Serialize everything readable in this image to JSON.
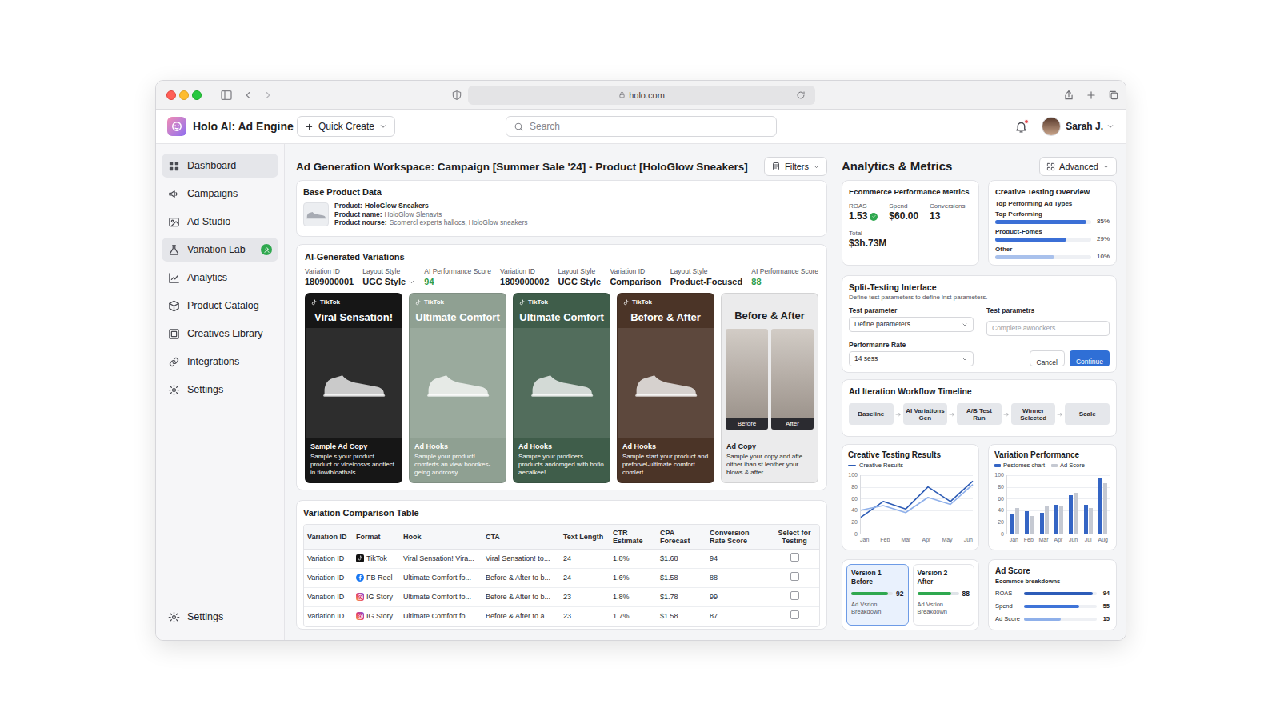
{
  "browser": {
    "url": "holo.com"
  },
  "header": {
    "logo": "Holo AI: Ad Engine",
    "quick_create": "Quick Create",
    "search": {
      "placeholder": "Search"
    },
    "notifications": {
      "unread": true
    },
    "user": "Sarah J."
  },
  "sidebar": {
    "items": [
      {
        "label": "Dashboard",
        "selected": true,
        "badge": false
      },
      {
        "label": "Campaigns",
        "selected": false,
        "badge": false
      },
      {
        "label": "Ad Studio",
        "selected": false,
        "badge": false
      },
      {
        "label": "Variation Lab",
        "selected": true,
        "badge": true
      },
      {
        "label": "Analytics",
        "selected": false,
        "badge": false
      },
      {
        "label": "Product Catalog",
        "selected": false,
        "badge": false
      },
      {
        "label": "Creatives Library",
        "selected": false,
        "badge": false
      },
      {
        "label": "Integrations",
        "selected": false,
        "badge": false
      },
      {
        "label": "Settings",
        "selected": false,
        "badge": false
      }
    ],
    "footer": {
      "label": "Settings",
      "selected": false
    }
  },
  "workspace": {
    "title": "Ad Generation Workspace: Campaign [Summer Sale '24] - Product [HoloGlow Sneakers]",
    "filters": "Filters",
    "product": {
      "heading": "Base Product Data",
      "fields": [
        {
          "label": "Product:",
          "value": "HoloGlow Sneakers",
          "kind": "primary"
        },
        {
          "label": "Product name:",
          "value": "HoloGlow Slenavts",
          "kind": "detail"
        },
        {
          "label": "Product nourse:",
          "value": "Scomercl experts hallocs, HoloGlow sneakers",
          "kind": "detail"
        }
      ]
    },
    "variations": {
      "heading": "AI-Generated Variations",
      "meta": [
        {
          "label": "Variation ID",
          "value": "1809000001",
          "kind": "text"
        },
        {
          "label": "Layout Style",
          "value": "UGC Style",
          "kind": "dropdown"
        },
        {
          "label": "AI Performance Score",
          "value": "94",
          "kind": "score"
        },
        {
          "label": "Variation ID",
          "value": "1809000002",
          "kind": "text"
        },
        {
          "label": "Layout Style",
          "value": "UGC Style",
          "kind": "text"
        },
        {
          "label": "Variation ID",
          "value": "Comparison",
          "kind": "text"
        },
        {
          "label": "Layout Style",
          "value": "Product-Focused",
          "kind": "text"
        },
        {
          "label": "AI Performance Score",
          "value": "88",
          "kind": "score"
        }
      ],
      "cards": [
        {
          "kind": "hero",
          "platform": "TikTok",
          "title": "Viral Sensation!",
          "copy_label": "Sample Ad Copy",
          "copy": "Sample s your product product or viceicosvs anotiect in tiowibloathals...",
          "color": "#161616"
        },
        {
          "kind": "hero",
          "platform": "TikTok",
          "title": "Ultimate Comfort",
          "copy_label": "Ad Hooks",
          "copy": "Sample your product! comferts an view boonkes-geing andrcosy...",
          "color": "#8fa092"
        },
        {
          "kind": "hero",
          "platform": "TikTok",
          "title": "Ultimate Comfort",
          "copy_label": "Ad Hooks",
          "copy": "Sampre your prodicers products andomged with hofio aecaikee!",
          "color": "#3f5d4a"
        },
        {
          "kind": "hero",
          "platform": "TikTok",
          "title": "Before & After",
          "copy_label": "Ad Hooks",
          "copy": "Sample start your product and preforvel-ultimate comfort comlert.",
          "color": "#4b3427"
        },
        {
          "kind": "split",
          "title": "Before & After",
          "panels": [
            "Before",
            "After"
          ],
          "copy_label": "Ad Copy",
          "copy": "Sample your copy and afte oither ihan st leother your blows & after.",
          "color": "#ebebec"
        }
      ]
    },
    "comparison": {
      "heading": "Variation Comparison Table",
      "columns": [
        "Variation ID",
        "Format",
        "Hook",
        "CTA",
        "Text Length",
        "CTR Estimate",
        "CPA Forecast",
        "Conversion Rate Score",
        "Select for Testing"
      ],
      "rows": [
        {
          "id": "Variation ID",
          "format": "TikTok",
          "platform": "tiktok",
          "hook": "Viral Sensation! Vira...",
          "cta": "Viral Sensation! to...",
          "length": "24",
          "ctr": "1.8%",
          "cpa": "$1.68",
          "score": "94",
          "selected": false
        },
        {
          "id": "Variation ID",
          "format": "FB Reel",
          "platform": "facebook",
          "hook": "Ultimate Comfort fo...",
          "cta": "Before & After to b...",
          "length": "24",
          "ctr": "1.6%",
          "cpa": "$1.58",
          "score": "88",
          "selected": false
        },
        {
          "id": "Variation ID",
          "format": "IG Story",
          "platform": "instagram",
          "hook": "Ultimate Comfort fo...",
          "cta": "Before & After to b...",
          "length": "23",
          "ctr": "1.8%",
          "cpa": "$1.78",
          "score": "99",
          "selected": false
        },
        {
          "id": "Variation ID",
          "format": "IG Story",
          "platform": "instagram",
          "hook": "Ultimate Comfort fo...",
          "cta": "Before & After to a...",
          "length": "23",
          "ctr": "1.7%",
          "cpa": "$1.58",
          "score": "87",
          "selected": false
        }
      ]
    }
  },
  "analytics": {
    "title": "Analytics & Metrics",
    "advanced": "Advanced",
    "ecommerce": {
      "title": "Ecommerce Performance Metrics",
      "metrics": [
        {
          "label": "ROAS",
          "value": "1.53",
          "verified": true
        },
        {
          "label": "Spend",
          "value": "$60.00",
          "verified": false
        },
        {
          "label": "Conversions",
          "value": "13",
          "verified": false
        }
      ],
      "total": {
        "label": "Total",
        "value": "$3h.73M"
      }
    },
    "overview": {
      "title": "Creative Testing Overview",
      "subtitle": "Top Performing Ad Types",
      "bars": [
        {
          "label": "Top Performing",
          "value": "85%",
          "level": 0.95,
          "color": "#3b6fd6"
        },
        {
          "label": "Product-Fomes",
          "value": "29%",
          "level": 0.74,
          "color": "#3b6fd6"
        },
        {
          "label": "Other",
          "value": "10%",
          "level": 0.62,
          "color": "#a9c1ec"
        }
      ]
    },
    "split_test": {
      "title": "Split-Testing Interface",
      "subtitle": "Define test parameters to define lnst parameters.",
      "parameter": {
        "label": "Test parameter",
        "value": "Define parameters"
      },
      "parameters": {
        "label": "Test parametrs",
        "placeholder": "Complete awoockers.."
      },
      "rate": {
        "label": "Performanre Rate",
        "value": "14 sess"
      },
      "cancel": "Cancel",
      "continue": "Continue"
    },
    "workflow": {
      "title": "Ad Iteration Workflow Timeline",
      "steps": [
        "Baseline",
        "AI Variations Gen",
        "A/B Test Run",
        "Winner Selected",
        "Scale"
      ]
    },
    "results_chart": {
      "title": "Creative Testing Results",
      "legend": {
        "label": "Creative Results",
        "color": "#2c5bb5"
      },
      "y_ticks": [
        "100",
        "80",
        "60",
        "40",
        "20",
        "0"
      ],
      "x_ticks": [
        "Jan",
        "Feb",
        "Mar",
        "Apr",
        "May",
        "Jun"
      ],
      "series": [
        {
          "values": [
            28,
            55,
            42,
            80,
            55,
            90
          ],
          "color": "#2c5bb5"
        },
        {
          "values": [
            40,
            48,
            36,
            62,
            50,
            84
          ],
          "color": "#8fb0ea"
        }
      ]
    },
    "performance_chart": {
      "title": "Variation Performance",
      "y_ticks": [
        "100",
        "80",
        "60",
        "40",
        "20",
        "0"
      ],
      "x_ticks": [
        "Jan",
        "Feb",
        "Mar",
        "Apr",
        "Jun",
        "Jul",
        "Aug"
      ],
      "series": [
        {
          "label": "Pestomes chart",
          "color": "#3565c4",
          "values": [
            34,
            38,
            36,
            50,
            66,
            50,
            95
          ]
        },
        {
          "label": "Ad Score",
          "color": "#c5c9d2",
          "values": [
            44,
            30,
            48,
            46,
            70,
            44,
            86
          ]
        }
      ]
    },
    "versions": [
      {
        "name": "Version 1",
        "stage": "Before",
        "score": "92",
        "level": 0.88,
        "caption": "Ad Vsrion Breakdown",
        "selected": true
      },
      {
        "name": "Version 2",
        "stage": "After",
        "score": "88",
        "level": 0.82,
        "caption": "Ad Vsrion Breakdown",
        "selected": false
      }
    ],
    "ad_score": {
      "title": "Ad Score",
      "subtitle": "Ecommce breakdowns",
      "rows": [
        {
          "label": "ROAS",
          "value": "94",
          "level": 0.95,
          "color": "#2d5cb8"
        },
        {
          "label": "Spend",
          "value": "55",
          "level": 0.76,
          "color": "#3f74d8"
        },
        {
          "label": "Ad Score",
          "value": "15",
          "level": 0.5,
          "color": "#8fb0ea"
        }
      ]
    }
  }
}
